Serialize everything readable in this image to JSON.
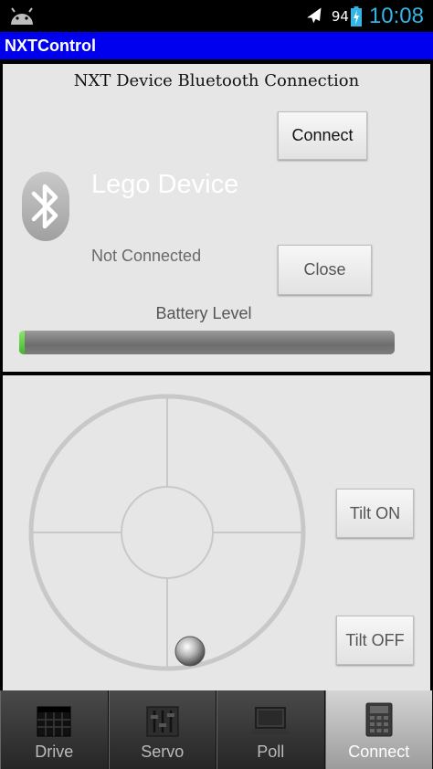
{
  "status_bar": {
    "battery_level": "94",
    "time": "10:08",
    "icons": [
      "android-icon",
      "airplane-mode-icon",
      "battery-charging-icon"
    ]
  },
  "app": {
    "title": "NXTControl"
  },
  "connection_panel": {
    "heading": "NXT Device Bluetooth Connection",
    "connect_label": "Connect",
    "device_name": "Lego Device",
    "status": "Not Connected",
    "close_label": "Close",
    "battery_label": "Battery Level",
    "battery_fraction": 0.015
  },
  "control_panel": {
    "tilt_on_label": "Tilt ON",
    "tilt_off_label": "Tilt OFF"
  },
  "tabs": [
    {
      "label": "Drive",
      "icon": "drive-grid-icon",
      "active": false
    },
    {
      "label": "Servo",
      "icon": "servo-sliders-icon",
      "active": false
    },
    {
      "label": "Poll",
      "icon": "poll-monitor-icon",
      "active": false
    },
    {
      "label": "Connect",
      "icon": "connect-device-icon",
      "active": true
    }
  ],
  "colors": {
    "title_bar": "#0000ee",
    "status_accent": "#33b5e5",
    "panel_bg": "#e6e6e6",
    "battery_fill": "#3fb82a"
  }
}
